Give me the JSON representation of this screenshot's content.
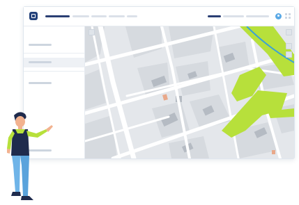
{
  "app": {
    "logo_icon": "cube-logo-icon",
    "brand_color": "#23417a"
  },
  "header": {
    "nav_tabs": [
      "",
      "",
      "",
      "",
      ""
    ],
    "user_icon": "user-avatar-icon",
    "apps_icon": "grid-icon"
  },
  "sidebar": {
    "items": [
      {
        "label": ""
      },
      {
        "label": ""
      },
      {
        "label": ""
      },
      {
        "label": ""
      }
    ],
    "active_index": 1
  },
  "map": {
    "park_color": "#b7e03b",
    "water_color": "#3aa0d8",
    "road_color": "#ffffff",
    "block_color": "#d5d9de",
    "building_color": "#b6bcc4",
    "poi_color": "#e9a98a",
    "controls": [
      "zoom-in-icon",
      "zoom-out-icon",
      "layers-icon",
      "fullscreen-icon"
    ]
  },
  "illustration": {
    "person_icon": "person-pointing-icon",
    "shirt_color": "#1f2b4d",
    "accent_color": "#b7e03b",
    "pants_color": "#6fb4e8"
  }
}
